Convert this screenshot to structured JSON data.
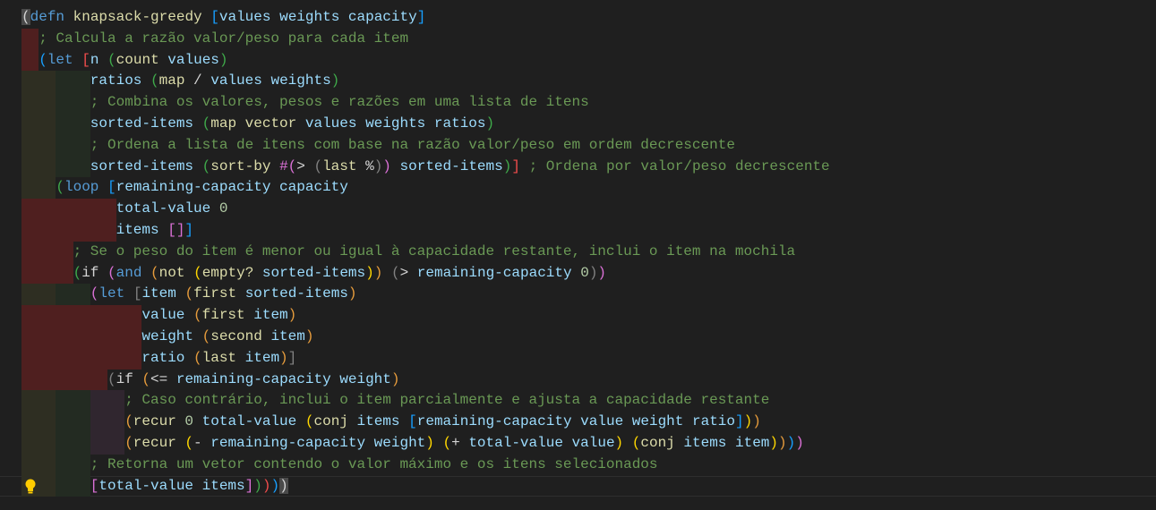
{
  "editor": {
    "lightbulb_icon": "lightbulb-icon",
    "lines": [
      [
        [
          "w",
          "("
        ],
        [
          "k",
          "defn"
        ],
        [
          "t",
          " "
        ],
        [
          "f",
          "knapsack-greedy"
        ],
        [
          "t",
          " "
        ],
        [
          "b",
          "["
        ],
        [
          "v",
          "values weights capacity"
        ],
        [
          "b",
          "]"
        ]
      ],
      [
        [
          "c",
          "; Calcula a razão valor/peso para cada item"
        ]
      ],
      [
        [
          "b",
          "("
        ],
        [
          "k",
          "let"
        ],
        [
          "t",
          " "
        ],
        [
          "r",
          "["
        ],
        [
          "v",
          "n"
        ],
        [
          "t",
          " "
        ],
        [
          "g",
          "("
        ],
        [
          "f",
          "count"
        ],
        [
          "t",
          " "
        ],
        [
          "v",
          "values"
        ],
        [
          "g",
          ")"
        ]
      ],
      [
        [
          "v",
          "ratios"
        ],
        [
          "t",
          " "
        ],
        [
          "g",
          "("
        ],
        [
          "f",
          "map"
        ],
        [
          "t",
          " / "
        ],
        [
          "v",
          "values weights"
        ],
        [
          "g",
          ")"
        ]
      ],
      [
        [
          "c",
          "; Combina os valores, pesos e razões em uma lista de itens"
        ]
      ],
      [
        [
          "v",
          "sorted-items"
        ],
        [
          "t",
          " "
        ],
        [
          "g",
          "("
        ],
        [
          "f",
          "map vector"
        ],
        [
          "t",
          " "
        ],
        [
          "v",
          "values weights ratios"
        ],
        [
          "g",
          ")"
        ]
      ],
      [
        [
          "c",
          "; Ordena a lista de itens com base na razão valor/peso em ordem decrescente"
        ]
      ],
      [
        [
          "v",
          "sorted-items"
        ],
        [
          "t",
          " "
        ],
        [
          "g",
          "("
        ],
        [
          "f",
          "sort-by"
        ],
        [
          "t",
          " "
        ],
        [
          "m",
          "#("
        ],
        [
          "t",
          "> "
        ],
        [
          "x",
          "("
        ],
        [
          "f",
          "last"
        ],
        [
          "t",
          " %"
        ],
        [
          "x",
          ")"
        ],
        [
          "m",
          ")"
        ],
        [
          "t",
          " "
        ],
        [
          "v",
          "sorted-items"
        ],
        [
          "g",
          ")"
        ],
        [
          "r",
          "]"
        ],
        [
          "t",
          " "
        ],
        [
          "c",
          "; Ordena por valor/peso decrescente"
        ]
      ],
      [
        [
          "g",
          "("
        ],
        [
          "k",
          "loop"
        ],
        [
          "t",
          " "
        ],
        [
          "b",
          "["
        ],
        [
          "v",
          "remaining-capacity capacity"
        ]
      ],
      [
        [
          "v",
          "total-value"
        ],
        [
          "t",
          " "
        ],
        [
          "n",
          "0"
        ]
      ],
      [
        [
          "v",
          "items"
        ],
        [
          "t",
          " "
        ],
        [
          "m",
          "[]"
        ],
        [
          "b",
          "]"
        ]
      ],
      [
        [
          "c",
          "; Se o peso do item é menor ou igual à capacidade restante, inclui o item na mochila"
        ]
      ],
      [
        [
          "g",
          "("
        ],
        [
          "t",
          "if"
        ],
        [
          "t",
          " "
        ],
        [
          "m",
          "("
        ],
        [
          "k",
          "and"
        ],
        [
          "t",
          " "
        ],
        [
          "o",
          "("
        ],
        [
          "f",
          "not"
        ],
        [
          "t",
          " "
        ],
        [
          "y",
          "("
        ],
        [
          "f",
          "empty?"
        ],
        [
          "t",
          " "
        ],
        [
          "v",
          "sorted-items"
        ],
        [
          "y",
          ")"
        ],
        [
          "o",
          ")"
        ],
        [
          "t",
          " "
        ],
        [
          "x",
          "("
        ],
        [
          "t",
          "> "
        ],
        [
          "v",
          "remaining-capacity"
        ],
        [
          "t",
          " "
        ],
        [
          "n",
          "0"
        ],
        [
          "x",
          ")"
        ],
        [
          "m",
          ")"
        ]
      ],
      [
        [
          "m",
          "("
        ],
        [
          "k",
          "let"
        ],
        [
          "t",
          " "
        ],
        [
          "x",
          "["
        ],
        [
          "v",
          "item"
        ],
        [
          "t",
          " "
        ],
        [
          "o",
          "("
        ],
        [
          "f",
          "first"
        ],
        [
          "t",
          " "
        ],
        [
          "v",
          "sorted-items"
        ],
        [
          "o",
          ")"
        ]
      ],
      [
        [
          "v",
          "value"
        ],
        [
          "t",
          " "
        ],
        [
          "o",
          "("
        ],
        [
          "f",
          "first"
        ],
        [
          "t",
          " "
        ],
        [
          "v",
          "item"
        ],
        [
          "o",
          ")"
        ]
      ],
      [
        [
          "v",
          "weight"
        ],
        [
          "t",
          " "
        ],
        [
          "o",
          "("
        ],
        [
          "f",
          "second"
        ],
        [
          "t",
          " "
        ],
        [
          "v",
          "item"
        ],
        [
          "o",
          ")"
        ]
      ],
      [
        [
          "v",
          "ratio"
        ],
        [
          "t",
          " "
        ],
        [
          "o",
          "("
        ],
        [
          "f",
          "last"
        ],
        [
          "t",
          " "
        ],
        [
          "v",
          "item"
        ],
        [
          "o",
          ")"
        ],
        [
          "x",
          "]"
        ]
      ],
      [
        [
          "x",
          "("
        ],
        [
          "t",
          "if"
        ],
        [
          "t",
          " "
        ],
        [
          "o",
          "("
        ],
        [
          "t",
          "<= "
        ],
        [
          "v",
          "remaining-capacity weight"
        ],
        [
          "o",
          ")"
        ]
      ],
      [
        [
          "c",
          "; Caso contrário, inclui o item parcialmente e ajusta a capacidade restante"
        ]
      ],
      [
        [
          "o",
          "("
        ],
        [
          "f",
          "recur"
        ],
        [
          "t",
          " "
        ],
        [
          "n",
          "0"
        ],
        [
          "t",
          " "
        ],
        [
          "v",
          "total-value"
        ],
        [
          "t",
          " "
        ],
        [
          "y",
          "("
        ],
        [
          "f",
          "conj"
        ],
        [
          "t",
          " "
        ],
        [
          "v",
          "items"
        ],
        [
          "t",
          " "
        ],
        [
          "b",
          "["
        ],
        [
          "v",
          "remaining-capacity value weight ratio"
        ],
        [
          "b",
          "]"
        ],
        [
          "y",
          ")"
        ],
        [
          "o",
          ")"
        ]
      ],
      [
        [
          "o",
          "("
        ],
        [
          "f",
          "recur"
        ],
        [
          "t",
          " "
        ],
        [
          "y",
          "("
        ],
        [
          "t",
          "- "
        ],
        [
          "v",
          "remaining-capacity weight"
        ],
        [
          "y",
          ")"
        ],
        [
          "t",
          " "
        ],
        [
          "y",
          "("
        ],
        [
          "t",
          "+ "
        ],
        [
          "v",
          "total-value value"
        ],
        [
          "y",
          ")"
        ],
        [
          "t",
          " "
        ],
        [
          "y",
          "("
        ],
        [
          "f",
          "conj"
        ],
        [
          "t",
          " "
        ],
        [
          "v",
          "items item"
        ],
        [
          "y",
          ")"
        ],
        [
          "o",
          ")"
        ],
        [
          "b",
          ")"
        ],
        [
          "m",
          ")"
        ]
      ],
      [
        [
          "c",
          "; Retorna um vetor contendo o valor máximo e os itens selecionados"
        ]
      ],
      [
        [
          "m",
          "["
        ],
        [
          "v",
          "total-value items"
        ],
        [
          "m",
          "]"
        ],
        [
          "g",
          ")"
        ],
        [
          "r",
          ")"
        ],
        [
          "b",
          ")"
        ],
        [
          "w",
          ")"
        ]
      ]
    ]
  }
}
